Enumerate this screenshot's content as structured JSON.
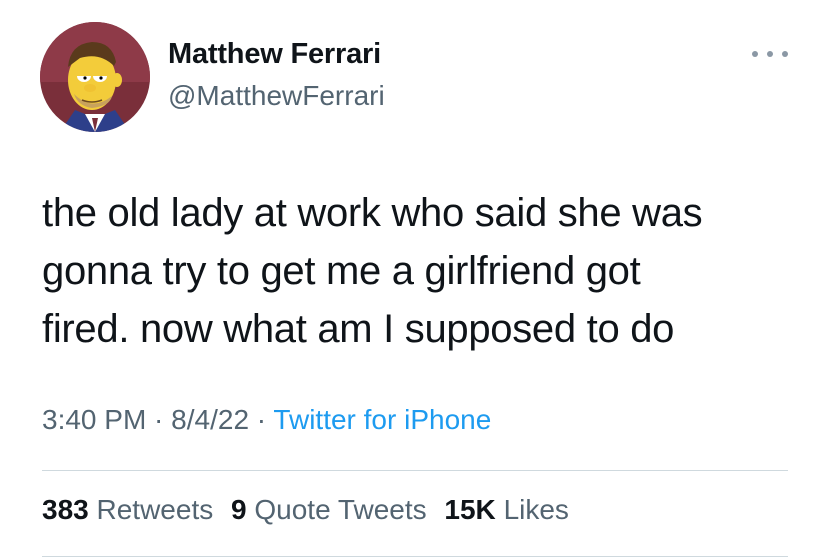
{
  "author": {
    "display_name": "Matthew Ferrari",
    "handle": "@MatthewFerrari",
    "avatar_icon": "cartoon-avatar-icon"
  },
  "more_icon": "more-options-icon",
  "tweet": {
    "text": "the old lady at work who said she was\ngonna try to get me a girlfriend got\nfired. now what am I supposed to do",
    "time": "3:40 PM",
    "separator": " · ",
    "date": "8/4/22",
    "source": "Twitter for iPhone"
  },
  "stats": {
    "retweets_count": "383",
    "retweets_label": "Retweets",
    "quotes_count": "9",
    "quotes_label": "Quote Tweets",
    "likes_count": "15K",
    "likes_label": "Likes"
  },
  "colors": {
    "text_primary": "#0f1419",
    "text_secondary": "#536471",
    "link": "#1d9bf0",
    "divider": "#cfd9de"
  }
}
